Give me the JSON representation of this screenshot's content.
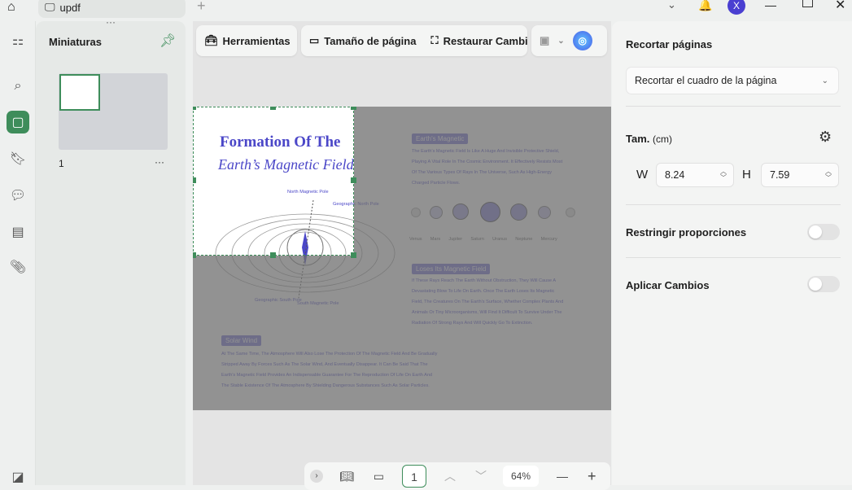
{
  "tab": {
    "title": "updf"
  },
  "thumbnails": {
    "title": "Miniaturas",
    "page_label": "1",
    "more": "···"
  },
  "toolbar": {
    "tools": "Herramientas",
    "page_size": "Tamaño de página",
    "restore": "Restaurar Cambio"
  },
  "document": {
    "title1": "Formation Of The",
    "title2": "Earth’s Magnetic Field",
    "north_mag": "North Magnetic Pole",
    "geo_north": "Geographic North Pole",
    "geo_south": "Geographic South Pole",
    "south_mag": "South Magnetic Pole",
    "label1": "Earth's Magnetic",
    "para1": [
      "The Earth's Magnetic Field Is Like A Huge And Invisible Protective Shield,",
      "Playing A Vital Role In The Cosmic Environment. It Effectively Resists Most",
      "Of The Various Types Of Rays In The Universe, Such As High-Energy",
      "Charged Particle Flows."
    ],
    "planets": [
      "Venus",
      "Mars",
      "Jupiter",
      "Saturn",
      "Uranus",
      "Neptune",
      "Mercury"
    ],
    "label2": "Loses Its Magnetic Field",
    "para2": [
      "If These Rays Reach The Earth Without Obstruction, They Will Cause A",
      "Devastating Blow To Life On Earth. Once The Earth Loses Its Magnetic",
      "Field, The Creatures On The Earth's Surface, Whether Complex Plants And",
      "Animals Or Tiny Microorganisms, Will Find It Difficult To Survive Under The",
      "Radiation Of Strong Rays And Will Quickly Go To Extinction."
    ],
    "label3": "Solar Wind",
    "para3": [
      "At The Same Time, The Atmosphere Will Also Lose The Protection Of The Magnetic Field And Be Gradually",
      "Stripped Away By Forces Such As The Solar Wind, And Eventually Disappear. It Can Be Said That The",
      "Earth's Magnetic Field Provides An Indispensable Guarantee For The Reproduction Of Life On Earth And",
      "The Stable Existence Of The Atmosphere By Shielding Dangerous Substances Such As Solar Particles."
    ]
  },
  "right": {
    "title": "Recortar páginas",
    "crop_box": "Recortar el cuadro de la página",
    "size_label": "Tam.",
    "size_unit": "(cm)",
    "w_label": "W",
    "w_value": "8.24",
    "h_label": "H",
    "h_value": "7.59",
    "constrain": "Restringir proporciones",
    "constrain_on": false,
    "apply": "Aplicar Cambios",
    "apply_on": false
  },
  "bottom": {
    "page": "1",
    "zoom": "64%"
  },
  "colors": {
    "accent": "#3e8d5b",
    "doc_text": "#4b47c8"
  }
}
